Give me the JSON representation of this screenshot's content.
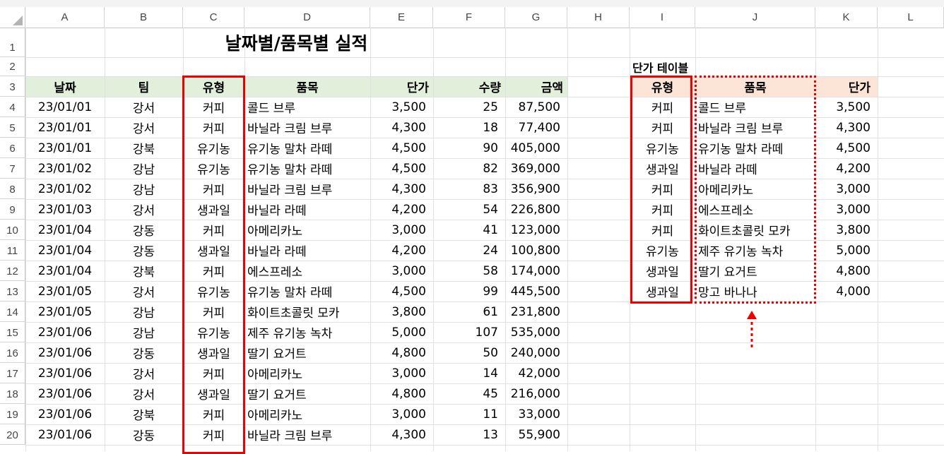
{
  "columns": [
    "A",
    "B",
    "C",
    "D",
    "E",
    "F",
    "G",
    "H",
    "I",
    "J",
    "K",
    "L"
  ],
  "rows": [
    "1",
    "2",
    "3",
    "4",
    "5",
    "6",
    "7",
    "8",
    "9",
    "10",
    "11",
    "12",
    "13",
    "14",
    "15",
    "16",
    "17",
    "18",
    "19",
    "20"
  ],
  "title": "날짜별/품목별 실적",
  "main_headers": [
    "날짜",
    "팀",
    "유형",
    "품목",
    "단가",
    "수량",
    "금액"
  ],
  "main_rows": [
    [
      "23/01/01",
      "강서",
      "커피",
      "콜드 브루",
      "3,500",
      "25",
      "87,500"
    ],
    [
      "23/01/01",
      "강서",
      "커피",
      "바닐라 크림 브루",
      "4,300",
      "18",
      "77,400"
    ],
    [
      "23/01/01",
      "강북",
      "유기농",
      "유기농 말차 라떼",
      "4,500",
      "90",
      "405,000"
    ],
    [
      "23/01/02",
      "강남",
      "유기농",
      "유기농 말차 라떼",
      "4,500",
      "82",
      "369,000"
    ],
    [
      "23/01/02",
      "강남",
      "커피",
      "바닐라 크림 브루",
      "4,300",
      "83",
      "356,900"
    ],
    [
      "23/01/03",
      "강서",
      "생과일",
      "바닐라 라떼",
      "4,200",
      "54",
      "226,800"
    ],
    [
      "23/01/04",
      "강동",
      "커피",
      "아메리카노",
      "3,000",
      "41",
      "123,000"
    ],
    [
      "23/01/04",
      "강동",
      "생과일",
      "바닐라 라떼",
      "4,200",
      "24",
      "100,800"
    ],
    [
      "23/01/04",
      "강북",
      "커피",
      "에스프레소",
      "3,000",
      "58",
      "174,000"
    ],
    [
      "23/01/05",
      "강서",
      "유기농",
      "유기농 말차 라떼",
      "4,500",
      "99",
      "445,500"
    ],
    [
      "23/01/05",
      "강남",
      "커피",
      "화이트초콜릿 모카",
      "3,800",
      "61",
      "231,800"
    ],
    [
      "23/01/06",
      "강남",
      "유기농",
      "제주 유기농 녹차",
      "5,000",
      "107",
      "535,000"
    ],
    [
      "23/01/06",
      "강동",
      "생과일",
      "딸기 요거트",
      "4,800",
      "50",
      "240,000"
    ],
    [
      "23/01/06",
      "강서",
      "커피",
      "아메리카노",
      "3,000",
      "14",
      "42,000"
    ],
    [
      "23/01/06",
      "강서",
      "생과일",
      "딸기 요거트",
      "4,800",
      "45",
      "216,000"
    ],
    [
      "23/01/06",
      "강북",
      "커피",
      "아메리카노",
      "3,000",
      "11",
      "33,000"
    ],
    [
      "23/01/06",
      "강동",
      "커피",
      "바닐라 크림 브루",
      "4,300",
      "13",
      "55,900"
    ]
  ],
  "price_table_title": "단가 테이블",
  "price_headers": [
    "유형",
    "품목",
    "단가"
  ],
  "price_rows": [
    [
      "커피",
      "콜드 브루",
      "3,500"
    ],
    [
      "커피",
      "바닐라 크림 브루",
      "4,300"
    ],
    [
      "유기농",
      "유기농 말차 라떼",
      "4,500"
    ],
    [
      "생과일",
      "바닐라 라떼",
      "4,200"
    ],
    [
      "커피",
      "아메리카노",
      "3,000"
    ],
    [
      "커피",
      "에스프레소",
      "3,000"
    ],
    [
      "커피",
      "화이트초콜릿 모카",
      "3,800"
    ],
    [
      "유기농",
      "제주 유기농 녹차",
      "5,000"
    ],
    [
      "생과일",
      "딸기 요거트",
      "4,800"
    ],
    [
      "생과일",
      "망고 바나나",
      "4,000"
    ]
  ],
  "colors": {
    "header_green": "#e2efda",
    "header_peach": "#fce4d6",
    "highlight_red": "#ee0000"
  }
}
